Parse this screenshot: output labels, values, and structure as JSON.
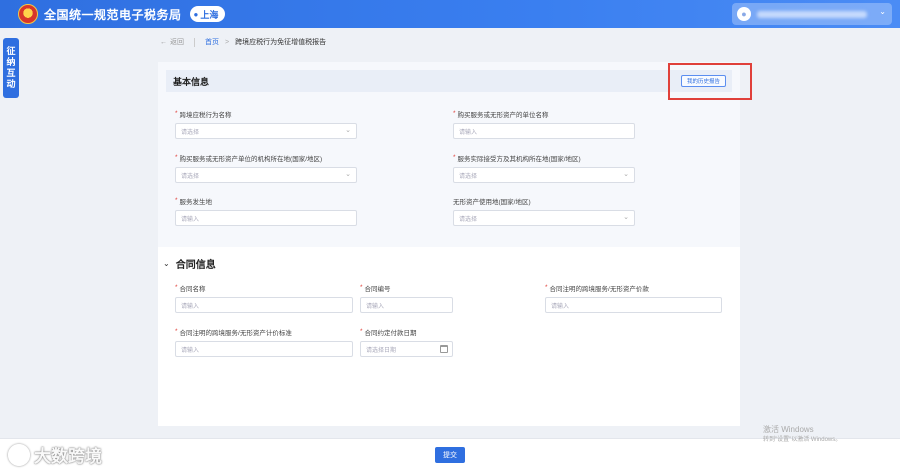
{
  "header": {
    "site_title": "全国统一规范电子税务局",
    "region": "上海",
    "user_name": "●●●●●●●●●●"
  },
  "side_tab": {
    "lines": [
      "征",
      "纳",
      "互",
      "动"
    ]
  },
  "breadcrumb": {
    "back": "返回",
    "home": "首页",
    "current": "跨境应税行为免征增值税报告"
  },
  "basic_info": {
    "title": "基本信息",
    "history_button": "我的历史报告",
    "fields": [
      {
        "label": "跨境应税行为名称",
        "placeholder": "请选择",
        "type": "select"
      },
      {
        "label": "购买服务或无形资产的单位名称",
        "placeholder": "请输入",
        "type": "input"
      },
      {
        "label": "购买服务或无形资产单位的机构所在地(国家/地区)",
        "placeholder": "请选择",
        "type": "select"
      },
      {
        "label": "服务实际接受方及其机构所在地(国家/地区)",
        "placeholder": "请选择",
        "type": "select"
      },
      {
        "label": "服务发生地",
        "placeholder": "请输入",
        "type": "input"
      },
      {
        "label": "无形资产使用地(国家/地区)",
        "placeholder": "请选择",
        "type": "select"
      }
    ]
  },
  "contract_info": {
    "title": "合同信息",
    "fields": [
      {
        "label": "合同名称",
        "placeholder": "请输入",
        "type": "input"
      },
      {
        "label": "合同编号",
        "placeholder": "请输入",
        "type": "input"
      },
      {
        "label": "合同注明的跨境服务/无形资产价款",
        "placeholder": "请输入",
        "type": "input"
      },
      {
        "label": "合同注明的跨境服务/无形资产计价标准",
        "placeholder": "请输入",
        "type": "input"
      },
      {
        "label": "合同约定付款日期",
        "placeholder": "请选择日期",
        "type": "date"
      }
    ]
  },
  "footer": {
    "submit": "提交"
  },
  "watermark": {
    "brand": "大数跨境"
  },
  "os_overlay": {
    "line1": "激活 Windows",
    "line2": "转到\"设置\"以激活 Windows。"
  },
  "colors": {
    "primary": "#2f6fe0",
    "required": "#e0403a",
    "highlight": "#e0403a"
  }
}
